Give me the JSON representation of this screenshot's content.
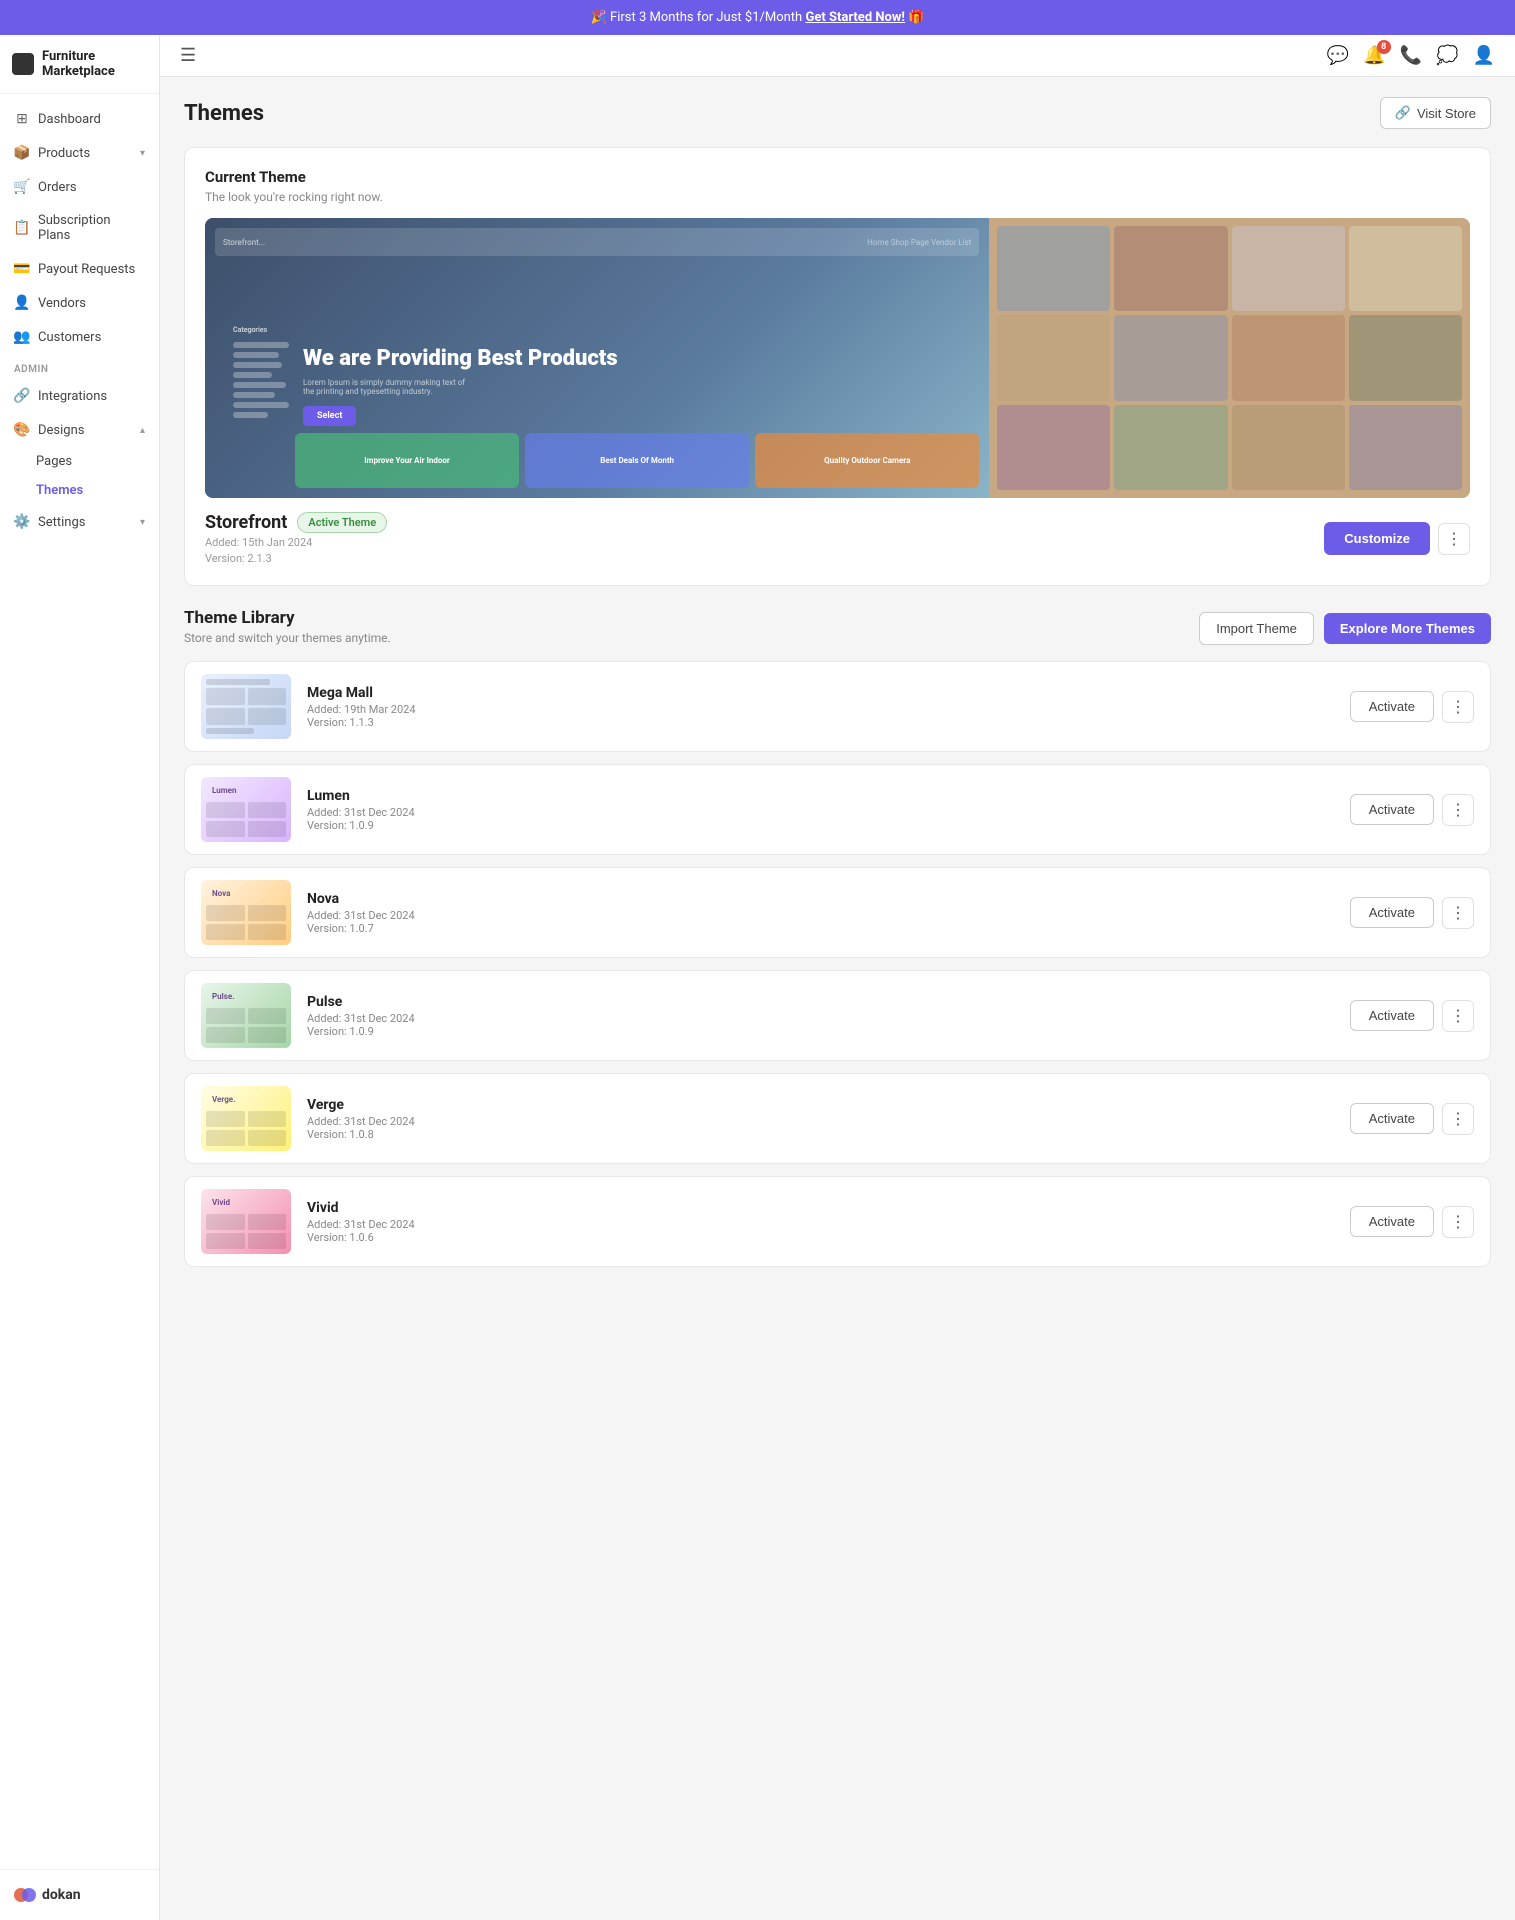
{
  "banner": {
    "text": "🎉 First 3 Months for Just $1/Month",
    "cta": "Get Started Now!",
    "emoji_end": "🎁"
  },
  "sidebar": {
    "logo": "Furniture Marketplace",
    "nav_items": [
      {
        "id": "dashboard",
        "label": "Dashboard",
        "icon": "⊞",
        "active": false
      },
      {
        "id": "products",
        "label": "Products",
        "icon": "📦",
        "active": false,
        "has_chevron": true
      },
      {
        "id": "orders",
        "label": "Orders",
        "icon": "🛒",
        "active": false
      },
      {
        "id": "subscription",
        "label": "Subscription Plans",
        "icon": "📋",
        "active": false
      },
      {
        "id": "payout",
        "label": "Payout Requests",
        "icon": "💳",
        "active": false
      },
      {
        "id": "vendors",
        "label": "Vendors",
        "icon": "👤",
        "active": false
      },
      {
        "id": "customers",
        "label": "Customers",
        "icon": "👥",
        "active": false
      }
    ],
    "admin_section": "ADMIN",
    "admin_items": [
      {
        "id": "integrations",
        "label": "Integrations",
        "icon": "🔗",
        "active": false
      },
      {
        "id": "designs",
        "label": "Designs",
        "icon": "🎨",
        "active": false,
        "has_chevron": true,
        "expanded": true
      },
      {
        "id": "settings",
        "label": "Settings",
        "icon": "⚙️",
        "active": false,
        "has_chevron": true
      }
    ],
    "designs_sub": [
      {
        "id": "pages",
        "label": "Pages",
        "active": false
      },
      {
        "id": "themes",
        "label": "Themes",
        "active": true
      }
    ],
    "dokan_label": "dokan"
  },
  "topbar": {
    "hamburger": "☰",
    "icons": [
      "💬",
      "🔔",
      "📞",
      "💭",
      "👤"
    ],
    "notification_count": "8"
  },
  "page": {
    "title": "Themes",
    "visit_store_label": "Visit Store"
  },
  "current_theme": {
    "section_label": "Current Theme",
    "section_sub": "The look you're rocking right now.",
    "preview_hero": "We are Providing Best Products",
    "theme_name": "Storefront",
    "active_badge": "Active Theme",
    "added_date": "Added: 15th Jan 2024",
    "version": "Version: 2.1.3",
    "customize_label": "Customize"
  },
  "theme_library": {
    "title": "Theme Library",
    "sub": "Store and switch your themes anytime.",
    "import_label": "Import Theme",
    "explore_label": "Explore More Themes",
    "themes": [
      {
        "id": "mega-mall",
        "name": "Mega Mall",
        "added": "Added: 19th Mar 2024",
        "version": "Version: 1.1.3",
        "color_class": "theme-thumb-mega",
        "label": ""
      },
      {
        "id": "lumen",
        "name": "Lumen",
        "added": "Added: 31st Dec 2024",
        "version": "Version: 1.0.9",
        "color_class": "theme-thumb-lumen",
        "label": "Lumen"
      },
      {
        "id": "nova",
        "name": "Nova",
        "added": "Added: 31st Dec 2024",
        "version": "Version: 1.0.7",
        "color_class": "theme-thumb-nova",
        "label": "Nova"
      },
      {
        "id": "pulse",
        "name": "Pulse",
        "added": "Added: 31st Dec 2024",
        "version": "Version: 1.0.9",
        "color_class": "theme-thumb-pulse",
        "label": "Pulse."
      },
      {
        "id": "verge",
        "name": "Verge",
        "added": "Added: 31st Dec 2024",
        "version": "Version: 1.0.8",
        "color_class": "theme-thumb-verge",
        "label": "Verge."
      },
      {
        "id": "vivid",
        "name": "Vivid",
        "added": "Added: 31st Dec 2024",
        "version": "Version: 1.0.6",
        "color_class": "theme-thumb-vivid",
        "label": "Vivid"
      }
    ],
    "activate_label": "Activate"
  }
}
